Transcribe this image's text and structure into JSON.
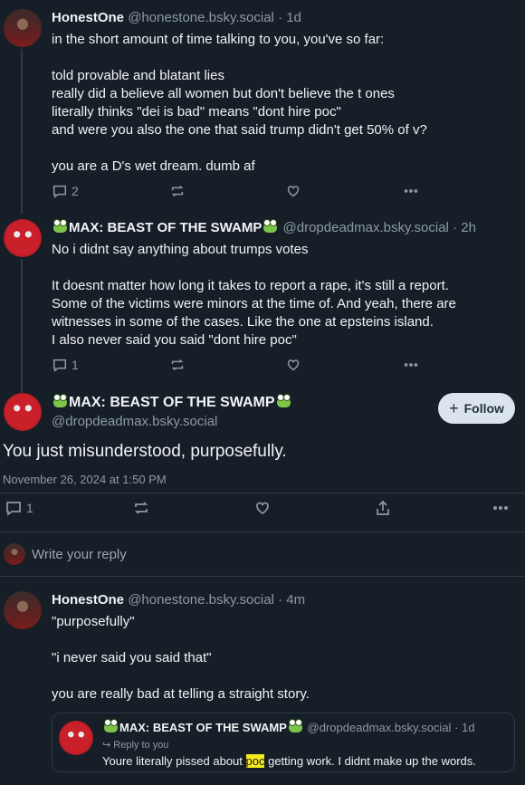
{
  "post1": {
    "name": "HonestOne",
    "handle": "@honestone.bsky.social",
    "age": "· 1d",
    "text": "in the short amount of time talking to you, you've so far:\n\ntold provable and blatant lies\nreally did a believe all women but don't believe the t ones\nliterally thinks \"dei is bad\" means \"dont hire poc\"\nand were you also the one that said trump didn't get 50% of v?\n\nyou are a D's wet dream. dumb af",
    "replies": "2"
  },
  "post2": {
    "name": "MAX: BEAST OF THE SWAMP",
    "handle": "@dropdeadmax.bsky.social",
    "age": "· 2h",
    "text": "No i didnt say anything about trumps votes\n\nIt doesnt matter how long it takes to report a rape, it's still a report.\nSome of the victims were minors at the time of. And yeah, there are\nwitnesses in some of the cases. Like the one at epsteins island.\nI also never said you said \"dont hire poc\"",
    "replies": "1"
  },
  "main": {
    "name": "MAX: BEAST OF THE SWAMP",
    "handle": "@dropdeadmax.bsky.social",
    "follow_label": "Follow",
    "text": "You just misunderstood, purposefully.",
    "timestamp": "November 26, 2024 at 1:50 PM",
    "replies": "1"
  },
  "composer": {
    "placeholder": "Write your reply"
  },
  "post3": {
    "name": "HonestOne",
    "handle": "@honestone.bsky.social",
    "age": "· 4m",
    "text": "\"purposefully\"\n\n\"i never said you said that\"\n\nyou are really bad at telling a straight story.",
    "quote": {
      "name": "MAX: BEAST OF THE SWAMP",
      "handle": "@dropdeadmax.bsky.social",
      "age": "· 1d",
      "reply_to": "Reply to you",
      "text_before": "Youre literally pissed about ",
      "highlight": "poc",
      "text_after": " getting work. I didnt make up the words."
    }
  },
  "colors": {
    "background": "#161e27",
    "muted": "#8d9aa8",
    "divider": "#2e3a46",
    "highlight": "#f5ea19"
  },
  "icons": [
    "reply-icon",
    "repost-icon",
    "like-icon",
    "more-icon",
    "share-icon",
    "plus-icon",
    "frog-emoji"
  ]
}
